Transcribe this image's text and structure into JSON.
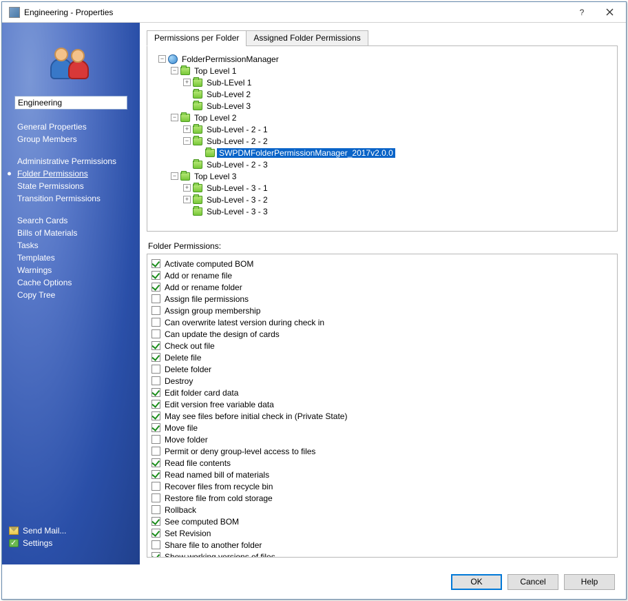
{
  "window": {
    "title": "Engineering - Properties"
  },
  "sidebar": {
    "input_value": "Engineering",
    "groups": [
      {
        "items": [
          {
            "label": "General Properties",
            "active": false
          },
          {
            "label": "Group Members",
            "active": false
          }
        ]
      },
      {
        "items": [
          {
            "label": "Administrative Permissions",
            "active": false
          },
          {
            "label": "Folder Permissions",
            "active": true
          },
          {
            "label": "State Permissions",
            "active": false
          },
          {
            "label": "Transition Permissions",
            "active": false
          }
        ]
      },
      {
        "items": [
          {
            "label": "Search Cards",
            "active": false
          },
          {
            "label": "Bills of Materials",
            "active": false
          },
          {
            "label": "Tasks",
            "active": false
          },
          {
            "label": "Templates",
            "active": false
          },
          {
            "label": "Warnings",
            "active": false
          },
          {
            "label": "Cache Options",
            "active": false
          },
          {
            "label": "Copy Tree",
            "active": false
          }
        ]
      }
    ],
    "footer": {
      "send_mail": "Send Mail...",
      "settings": "Settings"
    }
  },
  "tabs": [
    {
      "label": "Permissions per Folder",
      "active": true
    },
    {
      "label": "Assigned Folder Permissions",
      "active": false
    }
  ],
  "tree": {
    "root": {
      "label": "FolderPermissionManager",
      "icon": "globe",
      "expanded": true,
      "children": [
        {
          "label": "Top Level 1",
          "expanded": true,
          "children": [
            {
              "label": "Sub-LEvel 1",
              "expander": "+",
              "children": []
            },
            {
              "label": "Sub-Level 2",
              "expander": "",
              "children": []
            },
            {
              "label": "Sub-Level 3",
              "expander": "",
              "children": []
            }
          ]
        },
        {
          "label": "Top Level 2",
          "expanded": true,
          "children": [
            {
              "label": "Sub-Level - 2 - 1",
              "expander": "+",
              "children": []
            },
            {
              "label": "Sub-Level - 2 - 2",
              "expanded": true,
              "children": [
                {
                  "label": "SWPDMFolderPermissionManager_2017v2.0.0",
                  "selected": true,
                  "expander": "",
                  "children": []
                }
              ]
            },
            {
              "label": "Sub-Level - 2 - 3",
              "expander": "",
              "children": []
            }
          ]
        },
        {
          "label": "Top Level 3",
          "expanded": true,
          "children": [
            {
              "label": "Sub-Level - 3 - 1",
              "expander": "+",
              "children": []
            },
            {
              "label": "Sub-Level - 3 - 2",
              "expander": "+",
              "children": []
            },
            {
              "label": "Sub-Level - 3 - 3",
              "expander": "",
              "children": []
            }
          ]
        }
      ]
    }
  },
  "permissions_header": "Folder Permissions:",
  "permissions": [
    {
      "label": "Activate computed BOM",
      "checked": true
    },
    {
      "label": "Add or rename file",
      "checked": true
    },
    {
      "label": "Add or rename folder",
      "checked": true
    },
    {
      "label": "Assign file permissions",
      "checked": false
    },
    {
      "label": "Assign group membership",
      "checked": false
    },
    {
      "label": "Can overwrite latest version during check in",
      "checked": false
    },
    {
      "label": "Can update the design of cards",
      "checked": false
    },
    {
      "label": "Check out file",
      "checked": true
    },
    {
      "label": "Delete file",
      "checked": true
    },
    {
      "label": "Delete folder",
      "checked": false
    },
    {
      "label": "Destroy",
      "checked": false
    },
    {
      "label": "Edit folder card data",
      "checked": true
    },
    {
      "label": "Edit version free variable data",
      "checked": true
    },
    {
      "label": "May see files before initial check in (Private State)",
      "checked": true
    },
    {
      "label": "Move file",
      "checked": true
    },
    {
      "label": "Move folder",
      "checked": false
    },
    {
      "label": "Permit or deny group-level access to files",
      "checked": false
    },
    {
      "label": "Read file contents",
      "checked": true
    },
    {
      "label": "Read named bill of materials",
      "checked": true
    },
    {
      "label": "Recover files from recycle bin",
      "checked": false
    },
    {
      "label": "Restore file from cold storage",
      "checked": false
    },
    {
      "label": "Rollback",
      "checked": false
    },
    {
      "label": "See computed BOM",
      "checked": true
    },
    {
      "label": "Set Revision",
      "checked": true
    },
    {
      "label": "Share file to another folder",
      "checked": false
    },
    {
      "label": "Show working versions of files",
      "checked": true
    }
  ],
  "buttons": {
    "ok": "OK",
    "cancel": "Cancel",
    "help": "Help"
  }
}
